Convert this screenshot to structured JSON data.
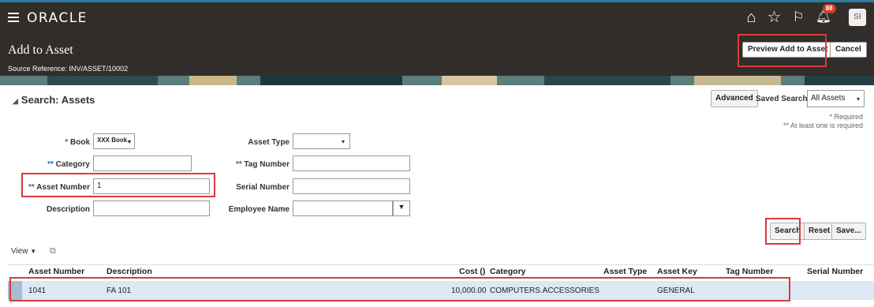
{
  "app": {
    "brand": "ORACLE",
    "avatar": "SI",
    "notification_count": "88"
  },
  "page": {
    "title": "Add to Asset",
    "source_reference": "Source Reference: INV/ASSET/10002",
    "preview_button": "Preview Add to Asset",
    "cancel_button": "Cancel"
  },
  "search": {
    "title": "Search: Assets",
    "advanced_button": "Advanced",
    "saved_search_label": "Saved Search",
    "saved_search_value": "All Assets",
    "required_note": "Required",
    "at_least_one_note": "** At least one is required",
    "fields": {
      "book_label": "Book",
      "book_value": "XXX Book",
      "category_label": "Category",
      "category_value": "",
      "asset_number_label": "Asset Number",
      "asset_number_value": "1",
      "description_label": "Description",
      "description_value": "",
      "asset_type_label": "Asset Type",
      "asset_type_value": "",
      "tag_number_label": "Tag Number",
      "tag_number_value": "",
      "serial_number_label": "Serial Number",
      "serial_number_value": "",
      "employee_name_label": "Employee Name",
      "employee_name_value": ""
    },
    "search_button": "Search",
    "reset_button": "Reset",
    "save_button": "Save..."
  },
  "results": {
    "view_label": "View",
    "columns": {
      "asset_number": "Asset Number",
      "description": "Description",
      "cost": "Cost ()",
      "category": "Category",
      "asset_type": "Asset Type",
      "asset_key": "Asset Key",
      "tag_number": "Tag Number",
      "serial_number": "Serial Number"
    },
    "rows": [
      {
        "asset_number": "1041",
        "description": "FA 101",
        "cost": "10,000.00",
        "category": "COMPUTERS.ACCESSORIES",
        "asset_type": "",
        "asset_key": "GENERAL",
        "tag_number": "",
        "serial_number": ""
      }
    ]
  },
  "colors": {
    "header_bg": "#312d2a",
    "highlight": "#d93a3a",
    "selected_row": "#dce9f5",
    "required_star": "#1f6fb5"
  }
}
